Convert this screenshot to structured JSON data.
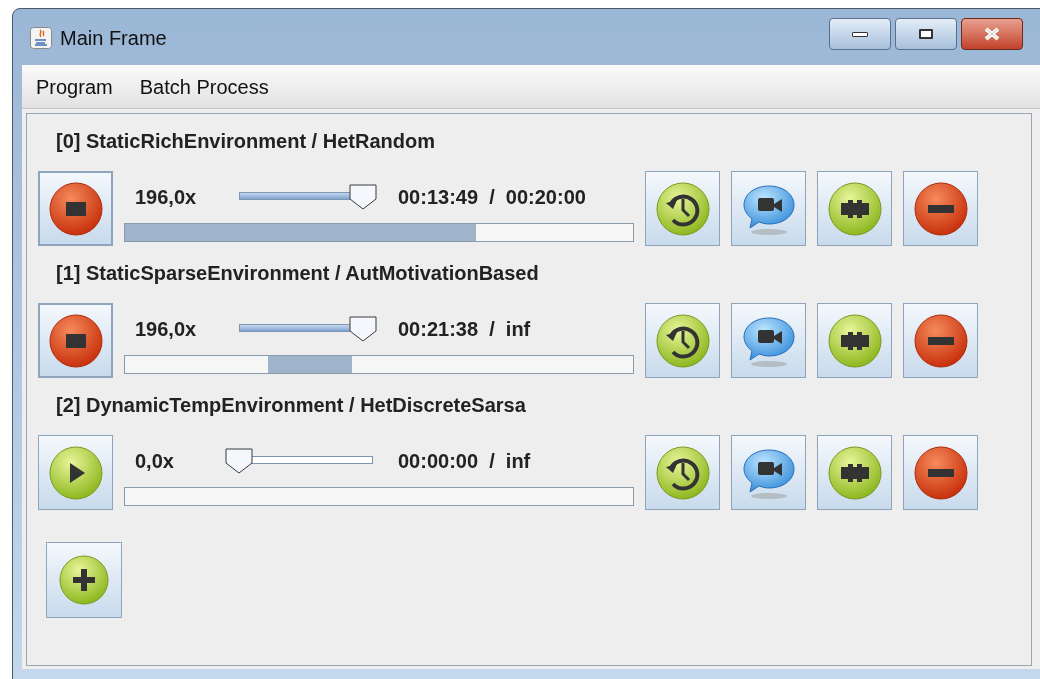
{
  "window": {
    "title": "Main Frame"
  },
  "menu": [
    "Program",
    "Batch Process"
  ],
  "simulations": [
    {
      "title": "[0] StaticRichEnvironment / HetRandom",
      "running": true,
      "speed": "196,0x",
      "speed_slider": {
        "level": 0.93
      },
      "time": "00:13:49  /  00:20:00",
      "progress": {
        "kind": "determinate",
        "level": 0.69
      }
    },
    {
      "title": "[1] StaticSparseEnvironment / AutMotivationBased",
      "running": true,
      "speed": "196,0x",
      "speed_slider": {
        "level": 0.93
      },
      "time": "00:21:38  /  inf",
      "progress": {
        "kind": "indeterminate"
      }
    },
    {
      "title": "[2] DynamicTempEnvironment / HetDiscreteSarsa",
      "running": false,
      "speed": "0,0x",
      "speed_slider": {
        "level": 0
      },
      "time": "00:00:00  /  inf",
      "progress": {
        "kind": "determinate",
        "level": 0
      }
    }
  ]
}
